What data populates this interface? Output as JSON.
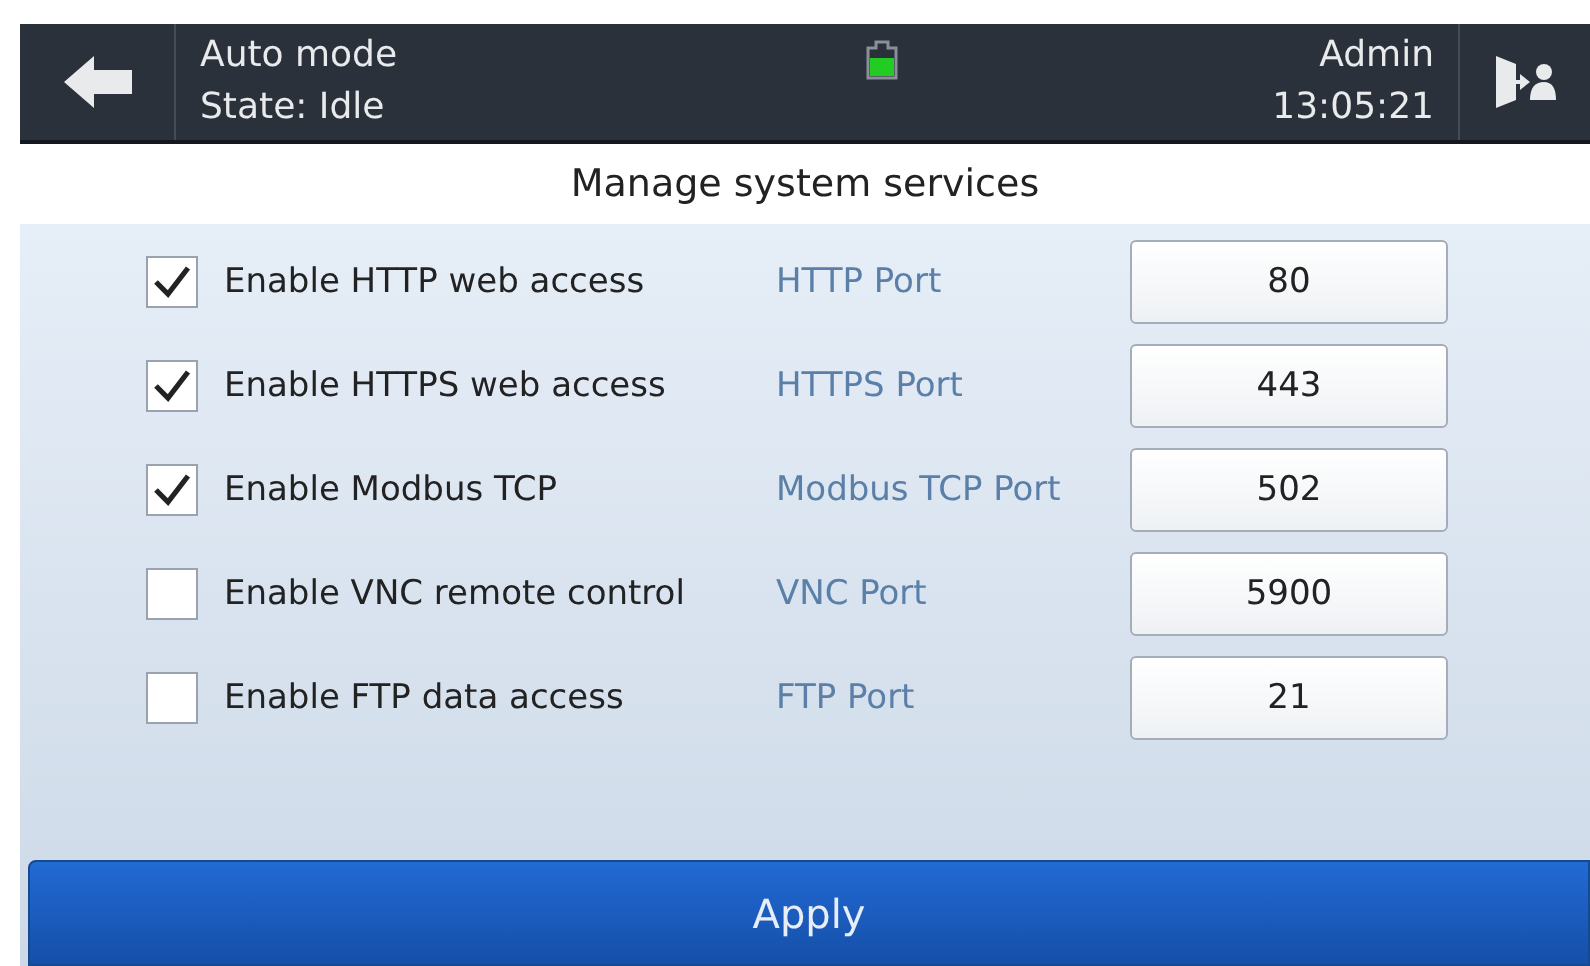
{
  "header": {
    "mode": "Auto mode",
    "state": "State: Idle",
    "user": "Admin",
    "time": "13:05:21"
  },
  "title": "Manage system services",
  "services": [
    {
      "label": "Enable HTTP web access",
      "checked": true,
      "port_label": "HTTP Port",
      "port": "80"
    },
    {
      "label": "Enable HTTPS web access",
      "checked": true,
      "port_label": "HTTPS Port",
      "port": "443"
    },
    {
      "label": "Enable Modbus TCP",
      "checked": true,
      "port_label": "Modbus TCP Port",
      "port": "502"
    },
    {
      "label": "Enable VNC remote control",
      "checked": false,
      "port_label": "VNC Port",
      "port": "5900"
    },
    {
      "label": "Enable FTP data access",
      "checked": false,
      "port_label": "FTP Port",
      "port": "21"
    }
  ],
  "apply": "Apply"
}
